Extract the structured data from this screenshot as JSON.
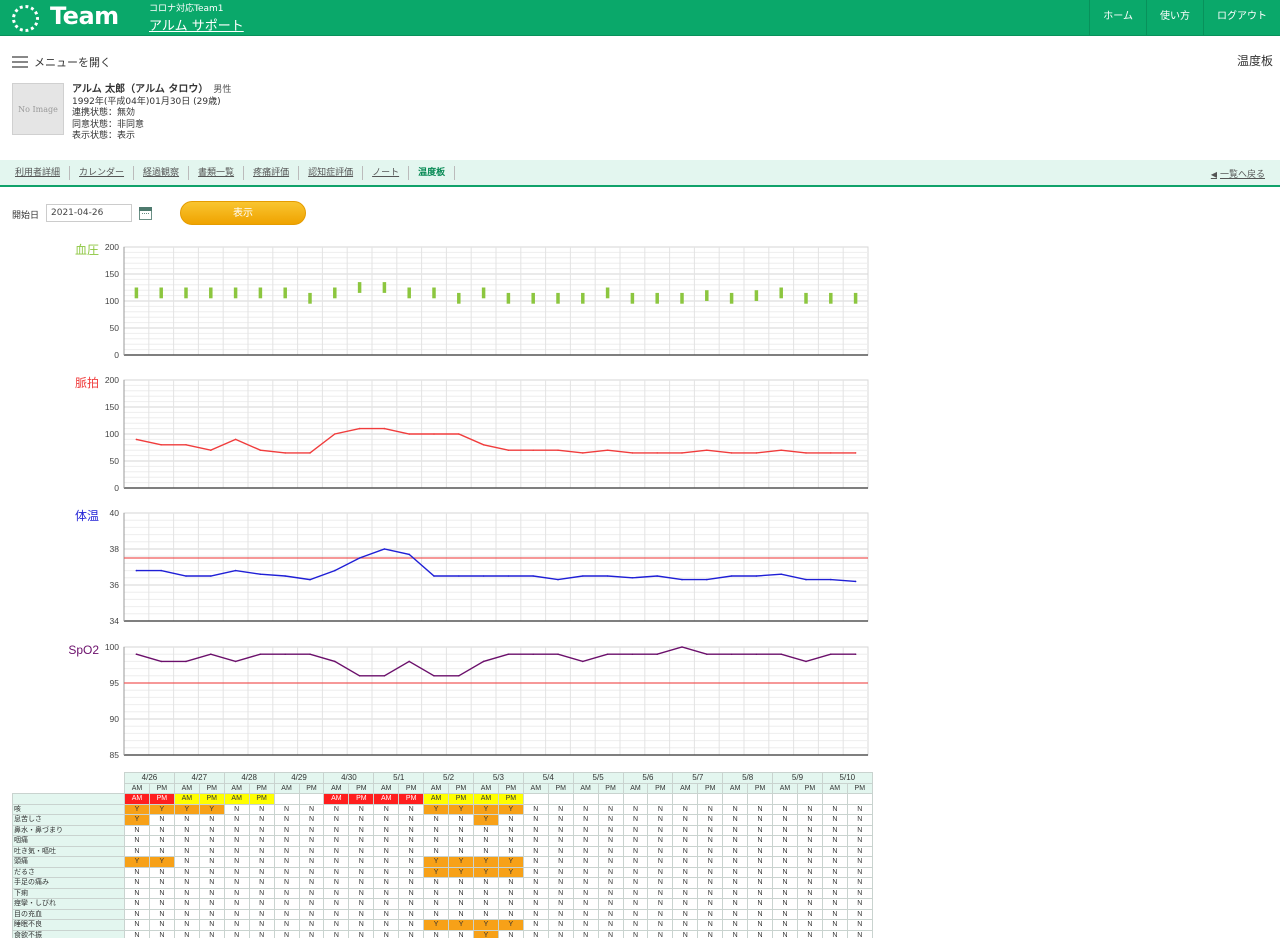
{
  "header": {
    "logo_text": "Team",
    "team_sub": "コロナ対応Team1",
    "team_main": "アルム サポート",
    "nav": [
      "ホーム",
      "使い方",
      "ログアウト"
    ]
  },
  "menu": {
    "open_label": "メニューを開く"
  },
  "page_title": "温度板",
  "profile": {
    "no_image": "No Image",
    "name": "アルム 太郎（アルム タロウ）",
    "gender": "男性",
    "birth": "1992年(平成04年)01月30日 (29歳)",
    "link_status": "連携状態：無効",
    "consent_status": "同意状態：非同意",
    "display_status": "表示状態：表示"
  },
  "tabs": [
    "利用者詳細",
    "カレンダー",
    "経過観察",
    "書類一覧",
    "疼痛評価",
    "認知症評価",
    "ノート",
    "温度板"
  ],
  "active_tab": "温度板",
  "back_link": "一覧へ戻る",
  "controls": {
    "start_label": "開始日",
    "start_date": "2021-04-26",
    "show_button": "表示"
  },
  "colors": {
    "brand": "#0aa86a",
    "bp": "#8cc63f",
    "pulse": "#f03c3c",
    "temp": "#1f1fd6",
    "spo2": "#6b0f6b",
    "threshold": "#f05a5a",
    "symptom_yes": "#f7a118"
  },
  "chart_data": [
    {
      "type": "bar",
      "title": "血圧",
      "ylim": [
        0,
        200
      ],
      "yticks": [
        0,
        50,
        100,
        150,
        200
      ],
      "grid": true,
      "values": [
        [
          105,
          125
        ],
        [
          105,
          125
        ],
        [
          105,
          125
        ],
        [
          105,
          125
        ],
        [
          105,
          125
        ],
        [
          105,
          125
        ],
        [
          105,
          125
        ],
        [
          95,
          115
        ],
        [
          105,
          125
        ],
        [
          115,
          135
        ],
        [
          115,
          135
        ],
        [
          105,
          125
        ],
        [
          105,
          125
        ],
        [
          95,
          115
        ],
        [
          105,
          125
        ],
        [
          95,
          115
        ],
        [
          95,
          115
        ],
        [
          95,
          115
        ],
        [
          95,
          115
        ],
        [
          105,
          125
        ],
        [
          95,
          115
        ],
        [
          95,
          115
        ],
        [
          95,
          115
        ],
        [
          100,
          120
        ],
        [
          95,
          115
        ],
        [
          100,
          120
        ],
        [
          105,
          125
        ],
        [
          95,
          115
        ],
        [
          95,
          115
        ],
        [
          95,
          115
        ]
      ]
    },
    {
      "type": "line",
      "title": "脈拍",
      "ylim": [
        0,
        200
      ],
      "yticks": [
        0,
        50,
        100,
        150,
        200
      ],
      "grid": true,
      "values": [
        90,
        80,
        80,
        70,
        90,
        70,
        65,
        65,
        100,
        110,
        110,
        100,
        100,
        100,
        80,
        70,
        70,
        70,
        65,
        70,
        65,
        65,
        65,
        70,
        65,
        65,
        70,
        65,
        65,
        65
      ]
    },
    {
      "type": "line",
      "title": "体温",
      "ylim": [
        34,
        40
      ],
      "yticks": [
        34,
        36,
        38,
        40
      ],
      "grid": true,
      "threshold": 37.5,
      "values": [
        36.8,
        36.8,
        36.5,
        36.5,
        36.8,
        36.6,
        36.5,
        36.3,
        36.8,
        37.5,
        38.0,
        37.7,
        36.5,
        36.5,
        36.5,
        36.5,
        36.5,
        36.3,
        36.5,
        36.5,
        36.4,
        36.5,
        36.3,
        36.3,
        36.5,
        36.5,
        36.6,
        36.3,
        36.3,
        36.2
      ]
    },
    {
      "type": "line",
      "title": "SpO2",
      "ylim": [
        85,
        100
      ],
      "yticks": [
        85,
        90,
        95,
        100
      ],
      "grid": true,
      "threshold": 95,
      "values": [
        99,
        98,
        98,
        99,
        98,
        99,
        99,
        99,
        98,
        96,
        96,
        98,
        96,
        96,
        98,
        99,
        99,
        99,
        98,
        99,
        99,
        99,
        100,
        99,
        99,
        99,
        99,
        98,
        99,
        99
      ]
    },
    {
      "type": "table",
      "days": [
        "4/26",
        "4/27",
        "4/28",
        "4/29",
        "4/30",
        "5/1",
        "5/2",
        "5/3",
        "5/4",
        "5/5",
        "5/6",
        "5/7",
        "5/8",
        "5/9",
        "5/10"
      ],
      "periods": [
        "AM",
        "PM"
      ],
      "period_colors": [
        "red",
        "red",
        "yellow",
        "yellow",
        "yellow",
        "yellow",
        "",
        "",
        "red",
        "red",
        "red",
        "red",
        "yellow",
        "yellow",
        "yellow",
        "yellow",
        "",
        "",
        "",
        "",
        "",
        "",
        "",
        "",
        "",
        "",
        "",
        "",
        "",
        ""
      ],
      "symptoms": [
        {
          "label": "咳",
          "values": "YYYYNNNNNNNNYYYYNNNNNNNNNNNNNNNNNNNNNNNNNNNNNNNNNNNNNNNNNNNN"
        },
        {
          "label": "息苦しさ",
          "values": "YNNNNNNNNNNNNNYNNNNNNNNNNNNNNNNNNNNNNNNNNNNNNNNNNNNNNNNNNNNN"
        },
        {
          "label": "鼻水・鼻づまり",
          "values": "NNNNNNNNNNNNNNNNNNNNNNNNNNNNNNNNNNNNNNNNNNNNNNNNNNNNNNNNNNNN"
        },
        {
          "label": "咽痛",
          "values": "NNNNNNNNNNNNNNNNNNNNNNNNNNNNNNNNNNNNNNNNNNNNNNNNNNNNNNNNNNNN"
        },
        {
          "label": "吐き気・嘔吐",
          "values": "NNNNNNNNNNNNNNNNNNNNNNNNNNNNNNNNNNNNNNNNNNNNNNNNNNNNNNNNNNNN"
        },
        {
          "label": "頭痛",
          "values": "YYNNNNNNNNNNYYYYNNNNNNNNNNNNNNNNNNNNNNNNNNNNNNNNNNNNNNNNNNNN"
        },
        {
          "label": "だるさ",
          "values": "NNNNNNNNNNNNYYYYNNNNNNNNNNNNNNNYNNNNNNNNNNNNNNNNNNNNNNNNNNNN"
        },
        {
          "label": "手足の痛み",
          "values": "NNNNNNNNNNNNNNNNNNNNNNNNNNNNNNNNNNNNNNNNNNNNNNNNNNNNNNNNNNNN"
        },
        {
          "label": "下痢",
          "values": "NNNNNNNNNNNNNNNNNNNNNNNNNNNNNNNNNNNNNNNNNNNNNNNNNNNNNNNNNNNN"
        },
        {
          "label": "痙攣・しびれ",
          "values": "NNNNNNNNNNNNNNNNNNNNNNNNNNNNNNNNNNNNNNNNNNNNNNNNNNNNNNNNNNNN"
        },
        {
          "label": "目の充血",
          "values": "NNNNNNNNNNNNNNNNNNNNNNNNNNNNNNNNNNNNNNNNNNNNNNNNNNNNNNNNNNNN"
        },
        {
          "label": "睡眠不良",
          "values": "NNNNNNNNNNNNYYYYNNNNNNNNNNNNNNNNNNNNNNNNNNNNNNNNNNNNNNNNNNNN"
        },
        {
          "label": "食欲不振",
          "values": "NNNNNNNNNNNNNNYNNNNNNNNNNNNNNNNNNNNNNNNNNNNNNNNNNNNNNNNNNNNN"
        }
      ]
    }
  ]
}
